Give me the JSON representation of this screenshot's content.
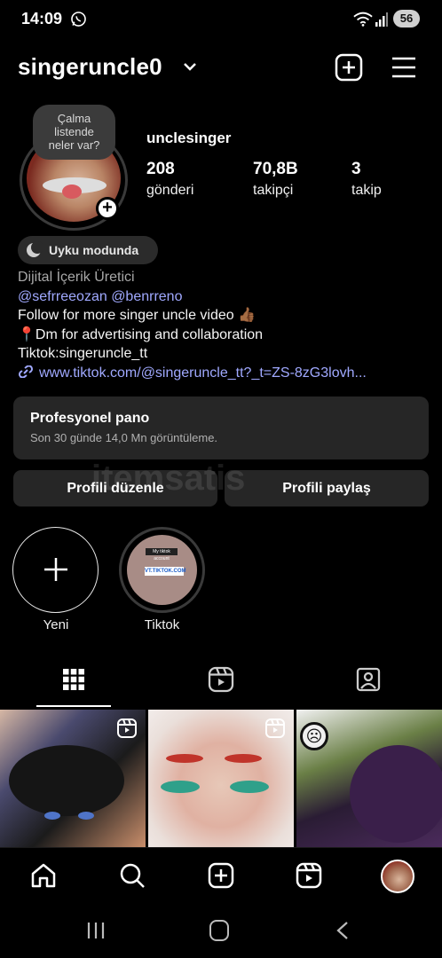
{
  "status_bar": {
    "time": "14:09",
    "battery": "56"
  },
  "header": {
    "username": "singeruncle0"
  },
  "profile": {
    "note": [
      "Çalma",
      "listende",
      "neler var?"
    ],
    "display_name": "unclesinger",
    "stats": [
      {
        "value": "208",
        "label": "gönderi"
      },
      {
        "value": "70,8B",
        "label": "takipçi"
      },
      {
        "value": "3",
        "label": "takip"
      }
    ],
    "sleep_mode": "Uyku modunda",
    "category": "Dijital İçerik Üretici",
    "mentions": [
      "@sefrreeozan",
      "@benrreno"
    ],
    "bio_line1": "Follow for more singer uncle video 👍🏾",
    "bio_line2": "📍Dm for advertising and collaboration",
    "bio_line3": "Tiktok:singeruncle_tt",
    "link": "www.tiktok.com/@singeruncle_tt?_t=ZS-8zG3lovh..."
  },
  "pro_dashboard": {
    "title": "Profesyonel pano",
    "subtitle": "Son 30 günde 14,0 Mn görüntüleme."
  },
  "buttons": {
    "edit": "Profili düzenle",
    "share": "Profili paylaş"
  },
  "watermark": "itemsatis",
  "highlights": [
    {
      "label": "Yeni"
    },
    {
      "label": "Tiktok",
      "thumb_text_1": "My tiktok account",
      "thumb_text_2": "VT.TIKTOK.COM"
    }
  ],
  "tabs": [
    "grid-icon",
    "reels-icon",
    "tagged-icon"
  ],
  "colors": {
    "background": "#000000",
    "card": "#262626",
    "link": "#a0a9ff",
    "category": "#a8a8a8"
  }
}
